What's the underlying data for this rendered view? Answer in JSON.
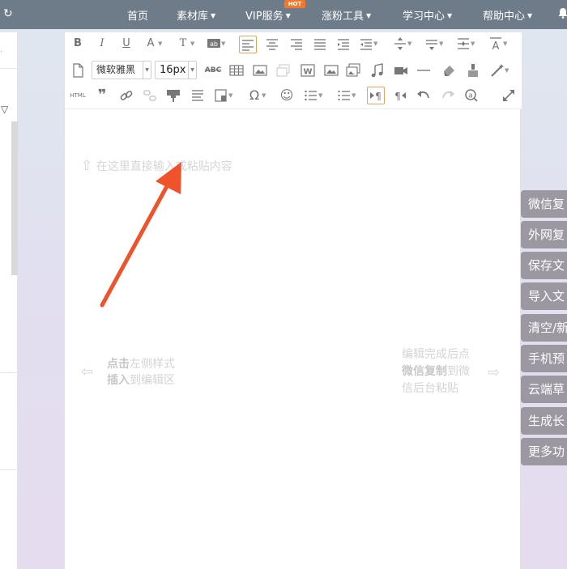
{
  "nav": {
    "items": [
      "首页",
      "素材库",
      "VIP服务",
      "涨粉工具",
      "学习中心",
      "帮助中心"
    ],
    "hot_badge": "HOT"
  },
  "toolbar": {
    "font_family": "微软雅黑",
    "font_size": "16px",
    "html_label": "HTML",
    "abc_label": "ABC",
    "w_label": "W"
  },
  "editor": {
    "placeholder": "在这里直接输入或粘贴内容",
    "left_hint": [
      "点击左侧样式",
      "插入到编辑区"
    ],
    "left_hint_bold": [
      "点击",
      "插入"
    ],
    "left_hint_rest": [
      "左侧样式",
      "到编辑区"
    ],
    "right_hint_line1": "编辑完成后点",
    "right_hint_line2_bold": "微信复制",
    "right_hint_line2_rest": "到微",
    "right_hint_line3": "信后台粘贴"
  },
  "side_buttons": [
    "微信复",
    "外网复",
    "保存文",
    "导入文",
    "清空/新",
    "手机预",
    "云端草",
    "生成长",
    "更多功"
  ],
  "colors": {
    "nav_bg": "#6e7c89",
    "side_button_bg": "#9b98a2",
    "arrow": "#f0522c",
    "active_border": "#e6a35a",
    "hot_badge": "#f5782a"
  }
}
